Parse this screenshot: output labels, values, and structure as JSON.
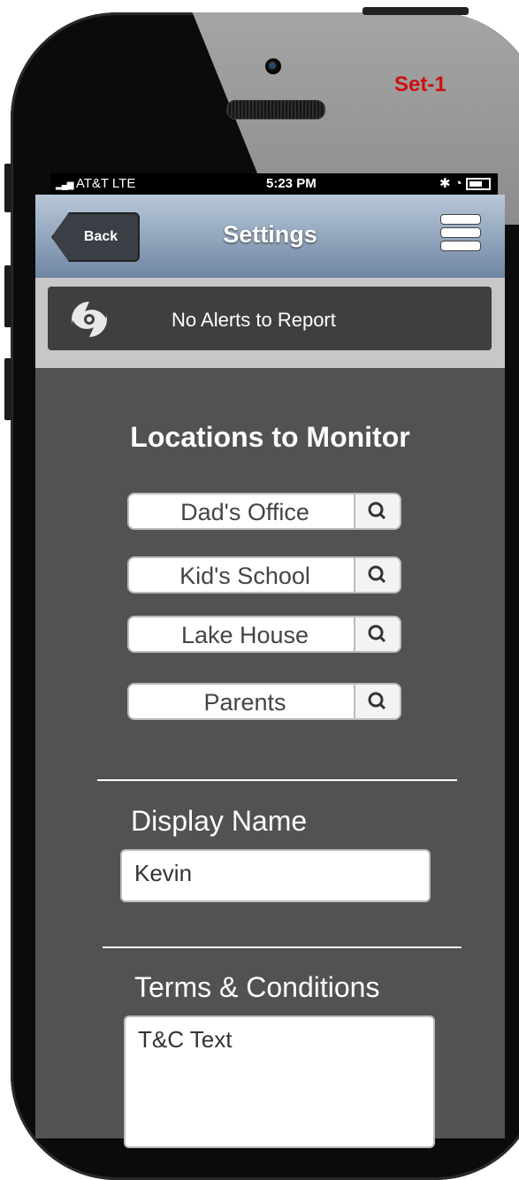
{
  "annotation": {
    "set_label": "Set-1"
  },
  "status_bar": {
    "carrier": "AT&T LTE",
    "time": "5:23 PM"
  },
  "nav": {
    "back_label": "Back",
    "title": "Settings"
  },
  "alert": {
    "text": "No Alerts to Report"
  },
  "locations": {
    "title": "Locations to Monitor",
    "items": [
      {
        "label": "Dad's Office"
      },
      {
        "label": "Kid's School"
      },
      {
        "label": "Lake House"
      },
      {
        "label": "Parents"
      }
    ]
  },
  "display_name": {
    "label": "Display Name",
    "value": "Kevin"
  },
  "terms": {
    "label": "Terms & Conditions",
    "value": "T&C Text"
  },
  "colors": {
    "nav_gradient_top": "#b8c8d8",
    "nav_gradient_bottom": "#6f86a3",
    "screen_bg": "#525252",
    "annotation_red": "#cc1111"
  }
}
